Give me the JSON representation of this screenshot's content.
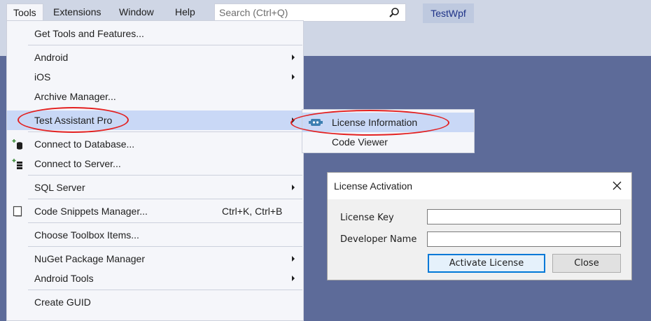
{
  "menubar": {
    "items": [
      {
        "label": "Tools"
      },
      {
        "label": "Extensions"
      },
      {
        "label": "Window"
      },
      {
        "label": "Help"
      }
    ],
    "search_placeholder": "Search (Ctrl+Q)",
    "project_name": "TestWpf"
  },
  "tools_menu": {
    "items": [
      {
        "label": "Get Tools and Features..."
      },
      {
        "label": "Android"
      },
      {
        "label": "iOS"
      },
      {
        "label": "Archive Manager..."
      },
      {
        "label": "Test Assistant Pro"
      },
      {
        "label": "Connect to Database..."
      },
      {
        "label": "Connect to Server..."
      },
      {
        "label": "SQL Server"
      },
      {
        "label": "Code Snippets Manager...",
        "shortcut": "Ctrl+K, Ctrl+B"
      },
      {
        "label": "Choose Toolbox Items..."
      },
      {
        "label": "NuGet Package Manager"
      },
      {
        "label": "Android Tools"
      },
      {
        "label": "Create GUID"
      }
    ]
  },
  "submenu": {
    "items": [
      {
        "label": "License Information"
      },
      {
        "label": "Code Viewer"
      }
    ]
  },
  "dialog": {
    "title": "License Activation",
    "license_key_label": "License Key",
    "license_key_value": "",
    "developer_name_label": "Developer Name",
    "developer_name_value": "",
    "activate_button": "Activate License",
    "close_button": "Close"
  },
  "colors": {
    "background": "#5d6b99",
    "menubar": "#cfd6e5",
    "highlight": "#c9d8f6",
    "annotation": "#e32020",
    "primary_button_border": "#0078d7"
  }
}
